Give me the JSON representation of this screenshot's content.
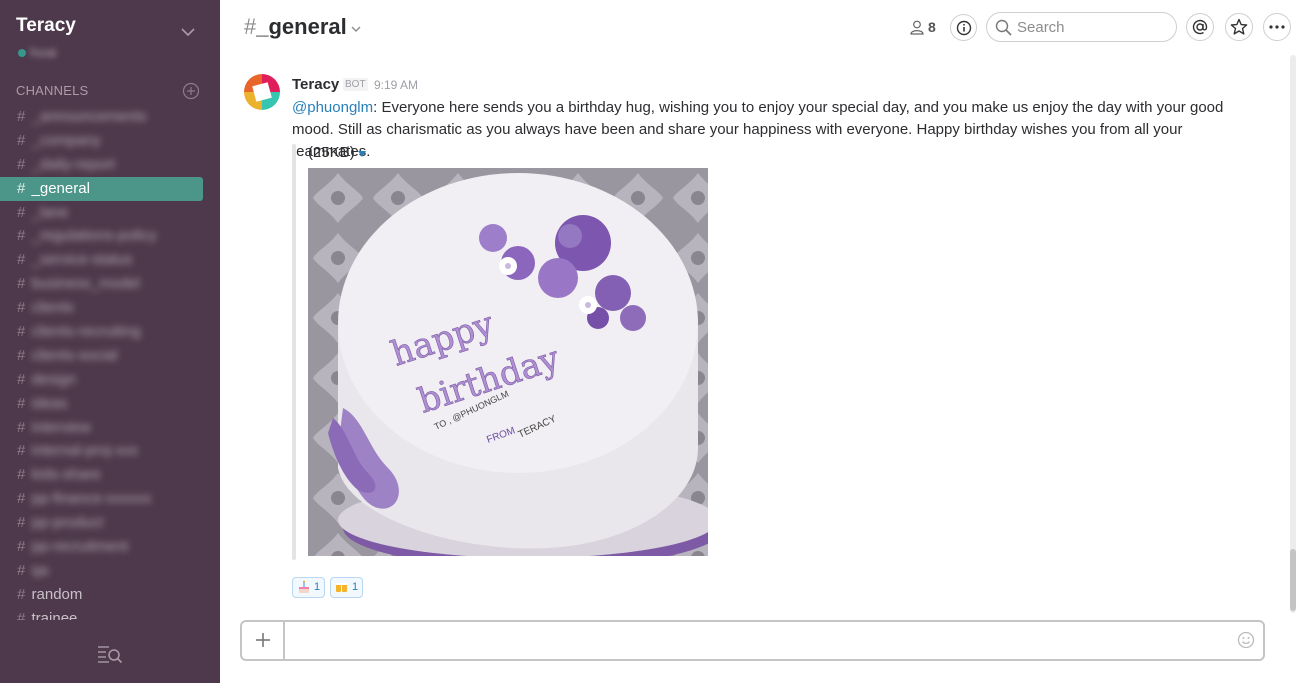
{
  "sidebar": {
    "team_name": "Teracy",
    "user_name": "hoai",
    "channels_header": "CHANNELS",
    "channels": [
      {
        "name": "_announcements",
        "blurred": true
      },
      {
        "name": "_company",
        "blurred": true
      },
      {
        "name": "_daily-report",
        "blurred": true
      },
      {
        "name": "_general",
        "active": true
      },
      {
        "name": "_lane",
        "blurred": true
      },
      {
        "name": "_regulations-policy",
        "blurred": true
      },
      {
        "name": "_service-status",
        "blurred": true
      },
      {
        "name": "business_model",
        "blurred": true
      },
      {
        "name": "clients",
        "blurred": true
      },
      {
        "name": "clients-recruiting",
        "blurred": true
      },
      {
        "name": "clients-social",
        "blurred": true
      },
      {
        "name": "design",
        "blurred": true
      },
      {
        "name": "ideas",
        "blurred": true
      },
      {
        "name": "interview",
        "blurred": true
      },
      {
        "name": "internal-proj-xxx",
        "blurred": true
      },
      {
        "name": "kids-share",
        "blurred": true
      },
      {
        "name": "pp-finance-xxxxxx",
        "blurred": true
      },
      {
        "name": "pp-product",
        "blurred": true
      },
      {
        "name": "pp-recruitment",
        "blurred": true
      },
      {
        "name": "qa",
        "blurred": true
      },
      {
        "name": "random"
      },
      {
        "name": "trainee"
      }
    ]
  },
  "header": {
    "channel_hash": "#",
    "channel_name": "_general",
    "member_count": "8",
    "search_placeholder": "Search"
  },
  "message": {
    "sender": "Teracy",
    "badge": "BOT",
    "time": "9:19 AM",
    "mention": "@phuonglm",
    "text": ": Everyone here sends you a birthday hug, wishing you to enjoy your special day, and you make us enjoy the day with your good mood. Still as charismatic as you always have been and share your happiness with everyone. Happy birthday wishes you from all your teammates.",
    "attachment": {
      "size": "(25KB)",
      "cake_text_1": "happy",
      "cake_text_2": "birthday",
      "cake_text_3": "TO , @PHUONGLM",
      "cake_text_4": "FROM",
      "cake_text_5": "TERACY"
    }
  },
  "reactions": [
    {
      "emoji": "birthday-cake",
      "count": "1"
    },
    {
      "emoji": "beers",
      "count": "1"
    }
  ],
  "composer": {
    "placeholder": ""
  },
  "colors": {
    "sidebar_bg": "#4d394b",
    "active_channel": "#4c9689",
    "presence": "#38978d",
    "link": "#2a80b9"
  }
}
